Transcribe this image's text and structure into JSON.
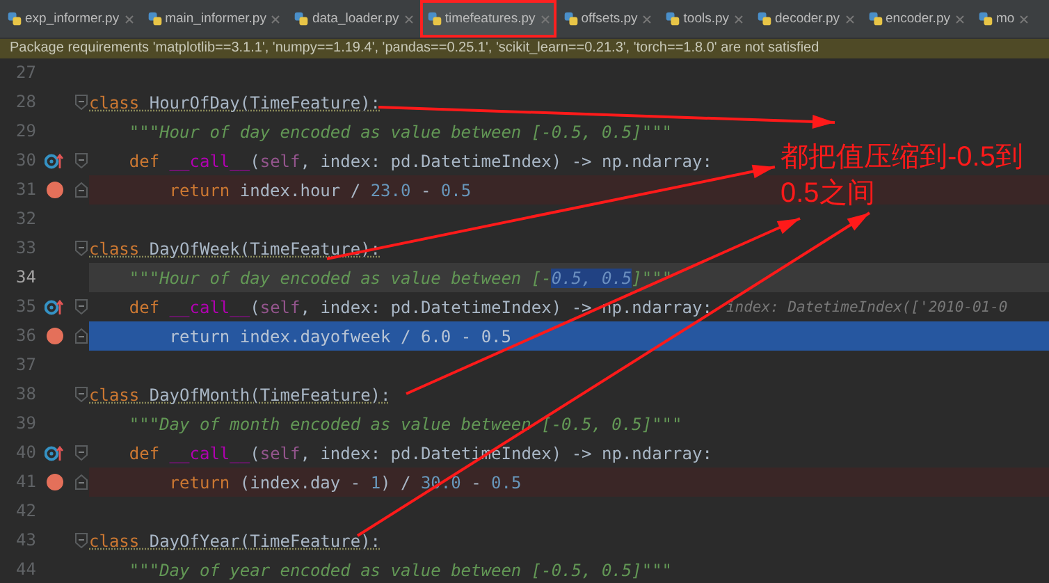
{
  "tabs": [
    {
      "label": "exp_informer.py",
      "selected": false,
      "annotated": false
    },
    {
      "label": "main_informer.py",
      "selected": false,
      "annotated": false
    },
    {
      "label": "data_loader.py",
      "selected": false,
      "annotated": false
    },
    {
      "label": "timefeatures.py",
      "selected": true,
      "annotated": true
    },
    {
      "label": "offsets.py",
      "selected": false,
      "annotated": false
    },
    {
      "label": "tools.py",
      "selected": false,
      "annotated": false
    },
    {
      "label": "decoder.py",
      "selected": false,
      "annotated": false
    },
    {
      "label": "encoder.py",
      "selected": false,
      "annotated": false
    },
    {
      "label": "mo",
      "selected": false,
      "annotated": false
    }
  ],
  "banner": {
    "text": "Package requirements 'matplotlib==3.1.1', 'numpy==1.19.4', 'pandas==0.25.1', 'scikit_learn==0.21.3', 'torch==1.8.0' are not satisfied"
  },
  "code_lines": [
    {
      "number": "27",
      "current": false,
      "execution": false,
      "breakpoint": false,
      "override": false,
      "fold_start": false,
      "fold_end": false
    },
    {
      "number": "28",
      "current": false,
      "execution": false,
      "breakpoint": false,
      "override": false,
      "fold_start": true,
      "fold_end": false,
      "warning": true,
      "tokens": [
        {
          "kind": "keyword",
          "text": "class"
        },
        {
          "kind": "plain",
          "text": " HourOfDay(TimeFeature):"
        }
      ]
    },
    {
      "number": "29",
      "current": false,
      "execution": false,
      "breakpoint": false,
      "override": false,
      "fold_start": false,
      "fold_end": false,
      "warning": false,
      "tokens": [
        {
          "kind": "docstring",
          "text": "    \"\"\"Hour of day encoded as value between [-0.5, 0.5]\"\"\""
        }
      ]
    },
    {
      "number": "30",
      "current": false,
      "execution": false,
      "breakpoint": false,
      "override": true,
      "fold_start": true,
      "fold_end": false,
      "warning": false,
      "tokens": [
        {
          "kind": "keyword",
          "text": "    def"
        },
        {
          "kind": "dunder",
          "text": " __call__"
        },
        {
          "kind": "plain",
          "text": "("
        },
        {
          "kind": "self",
          "text": "self"
        },
        {
          "kind": "plain",
          "text": ", index: pd.DatetimeIndex) -> np.ndarray:"
        }
      ]
    },
    {
      "number": "31",
      "current": false,
      "execution": false,
      "breakpoint": true,
      "override": false,
      "fold_start": false,
      "fold_end": true,
      "warning": false,
      "tokens": [
        {
          "kind": "keyword",
          "text": "        return"
        },
        {
          "kind": "plain",
          "text": " index.hour / "
        },
        {
          "kind": "number",
          "text": "23.0"
        },
        {
          "kind": "plain",
          "text": " - "
        },
        {
          "kind": "number",
          "text": "0.5"
        }
      ]
    },
    {
      "number": "32",
      "current": false,
      "execution": false,
      "breakpoint": false,
      "override": false,
      "fold_start": false,
      "fold_end": false
    },
    {
      "number": "33",
      "current": false,
      "execution": false,
      "breakpoint": false,
      "override": false,
      "fold_start": true,
      "fold_end": false,
      "warning": true,
      "tokens": [
        {
          "kind": "keyword",
          "text": "class"
        },
        {
          "kind": "plain",
          "text": " DayOfWeek(TimeFeature):"
        }
      ]
    },
    {
      "number": "34",
      "current": true,
      "execution": false,
      "breakpoint": false,
      "override": false,
      "fold_start": false,
      "fold_end": false,
      "warning": false,
      "tokens": [
        {
          "kind": "docstring",
          "text": "    \"\"\"Hour of day encoded as value between [-"
        },
        {
          "kind": "docstring-selected",
          "text": "0.5, 0.5"
        },
        {
          "kind": "docstring",
          "text": "]\"\"\""
        }
      ]
    },
    {
      "number": "35",
      "current": false,
      "execution": false,
      "breakpoint": false,
      "override": true,
      "fold_start": true,
      "fold_end": false,
      "warning": false,
      "tokens": [
        {
          "kind": "keyword",
          "text": "    def"
        },
        {
          "kind": "dunder",
          "text": " __call__"
        },
        {
          "kind": "plain",
          "text": "("
        },
        {
          "kind": "self",
          "text": "self"
        },
        {
          "kind": "plain",
          "text": ", index: pd.DatetimeIndex) -> np.ndarray:"
        },
        {
          "kind": "hint",
          "text": "index: DatetimeIndex(['2010-01-0"
        }
      ]
    },
    {
      "number": "36",
      "current": false,
      "execution": true,
      "breakpoint": true,
      "override": false,
      "fold_start": false,
      "fold_end": true,
      "warning": false,
      "tokens": [
        {
          "kind": "keyword",
          "text": "        return"
        },
        {
          "kind": "plain",
          "text": " index.dayofweek / "
        },
        {
          "kind": "number",
          "text": "6.0"
        },
        {
          "kind": "plain",
          "text": " - "
        },
        {
          "kind": "number",
          "text": "0.5"
        }
      ]
    },
    {
      "number": "37",
      "current": false,
      "execution": false,
      "breakpoint": false,
      "override": false,
      "fold_start": false,
      "fold_end": false
    },
    {
      "number": "38",
      "current": false,
      "execution": false,
      "breakpoint": false,
      "override": false,
      "fold_start": true,
      "fold_end": false,
      "warning": true,
      "tokens": [
        {
          "kind": "keyword",
          "text": "class"
        },
        {
          "kind": "plain",
          "text": " DayOfMonth(TimeFeature):"
        }
      ]
    },
    {
      "number": "39",
      "current": false,
      "execution": false,
      "breakpoint": false,
      "override": false,
      "fold_start": false,
      "fold_end": false,
      "warning": false,
      "tokens": [
        {
          "kind": "docstring",
          "text": "    \"\"\"Day of month encoded as value between [-0.5, 0.5]\"\"\""
        }
      ]
    },
    {
      "number": "40",
      "current": false,
      "execution": false,
      "breakpoint": false,
      "override": true,
      "fold_start": true,
      "fold_end": false,
      "warning": false,
      "tokens": [
        {
          "kind": "keyword",
          "text": "    def"
        },
        {
          "kind": "dunder",
          "text": " __call__"
        },
        {
          "kind": "plain",
          "text": "("
        },
        {
          "kind": "self",
          "text": "self"
        },
        {
          "kind": "plain",
          "text": ", index: pd.DatetimeIndex) -> np.ndarray:"
        }
      ]
    },
    {
      "number": "41",
      "current": false,
      "execution": false,
      "breakpoint": true,
      "override": false,
      "fold_start": false,
      "fold_end": true,
      "warning": false,
      "tokens": [
        {
          "kind": "keyword",
          "text": "        return"
        },
        {
          "kind": "plain",
          "text": " (index.day - "
        },
        {
          "kind": "number",
          "text": "1"
        },
        {
          "kind": "plain",
          "text": ") / "
        },
        {
          "kind": "number",
          "text": "30.0"
        },
        {
          "kind": "plain",
          "text": " - "
        },
        {
          "kind": "number",
          "text": "0.5"
        }
      ]
    },
    {
      "number": "42",
      "current": false,
      "execution": false,
      "breakpoint": false,
      "override": false,
      "fold_start": false,
      "fold_end": false
    },
    {
      "number": "43",
      "current": false,
      "execution": false,
      "breakpoint": false,
      "override": false,
      "fold_start": true,
      "fold_end": false,
      "warning": true,
      "tokens": [
        {
          "kind": "keyword",
          "text": "class"
        },
        {
          "kind": "plain",
          "text": " DayOfYear(TimeFeature):"
        }
      ]
    },
    {
      "number": "44",
      "current": false,
      "execution": false,
      "breakpoint": false,
      "override": false,
      "fold_start": false,
      "fold_end": false,
      "warning": false,
      "tokens": [
        {
          "kind": "docstring",
          "text": "    \"\"\"Day of year encoded as value between [-0.5, 0.5]\"\"\""
        }
      ]
    }
  ],
  "annotation": {
    "text": "都把值压缩到-0.5到0.5之间"
  }
}
